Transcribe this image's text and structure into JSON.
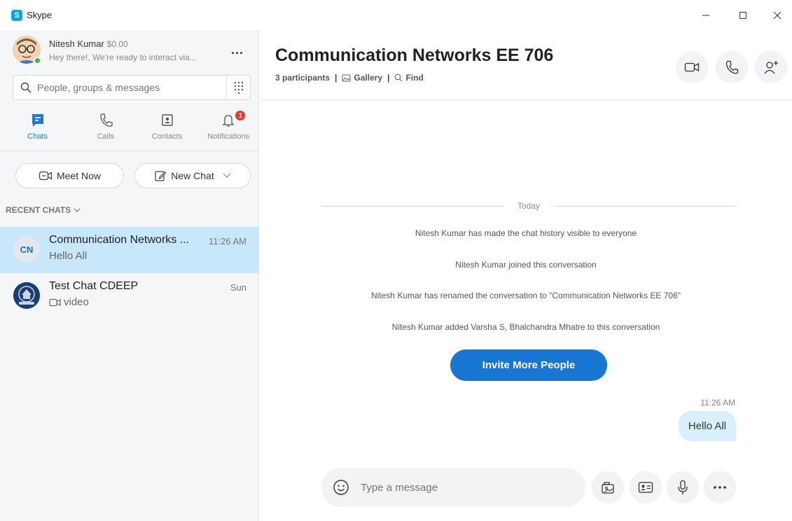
{
  "window": {
    "title": "Skype",
    "app_icon_letter": "S"
  },
  "profile": {
    "name": "Nitesh Kumar",
    "credit": "$0.00",
    "mood": "Hey there!, We're ready to interact via...",
    "more": "..."
  },
  "search": {
    "placeholder": "People, groups & messages"
  },
  "nav": {
    "chats": "Chats",
    "calls": "Calls",
    "contacts": "Contacts",
    "notifications": "Notifications",
    "notifications_badge": "1"
  },
  "actions": {
    "meet_now": "Meet Now",
    "new_chat": "New Chat"
  },
  "recent_chats": {
    "header": "RECENT CHATS",
    "items": [
      {
        "initials": "CN",
        "title": "Communication Networks ...",
        "preview": "Hello All",
        "time": "11:26 AM"
      },
      {
        "initials": "",
        "title": "Test Chat CDEEP",
        "preview": "video",
        "time": "Sun"
      }
    ]
  },
  "conversation": {
    "title": "Communication Networks EE 706",
    "participants": "3 participants",
    "gallery": "Gallery",
    "find": "Find",
    "day_divider": "Today",
    "system_messages": [
      "Nitesh Kumar has made the chat history visible to everyone",
      "Nitesh Kumar joined this conversation",
      "Nitesh Kumar has renamed the conversation to \"Communication Networks EE 706\"",
      "Nitesh Kumar added Varsha S, Bhalchandra Mhatre to this conversation"
    ],
    "invite_button": "Invite More People",
    "message": {
      "time": "11:26 AM",
      "text": "Hello All"
    }
  },
  "composer": {
    "placeholder": "Type a message"
  },
  "colors": {
    "accent": "#1976d2",
    "selected_chat": "#c9e7fa",
    "sidebar": "#f4f6f8",
    "badge": "#e53935"
  }
}
